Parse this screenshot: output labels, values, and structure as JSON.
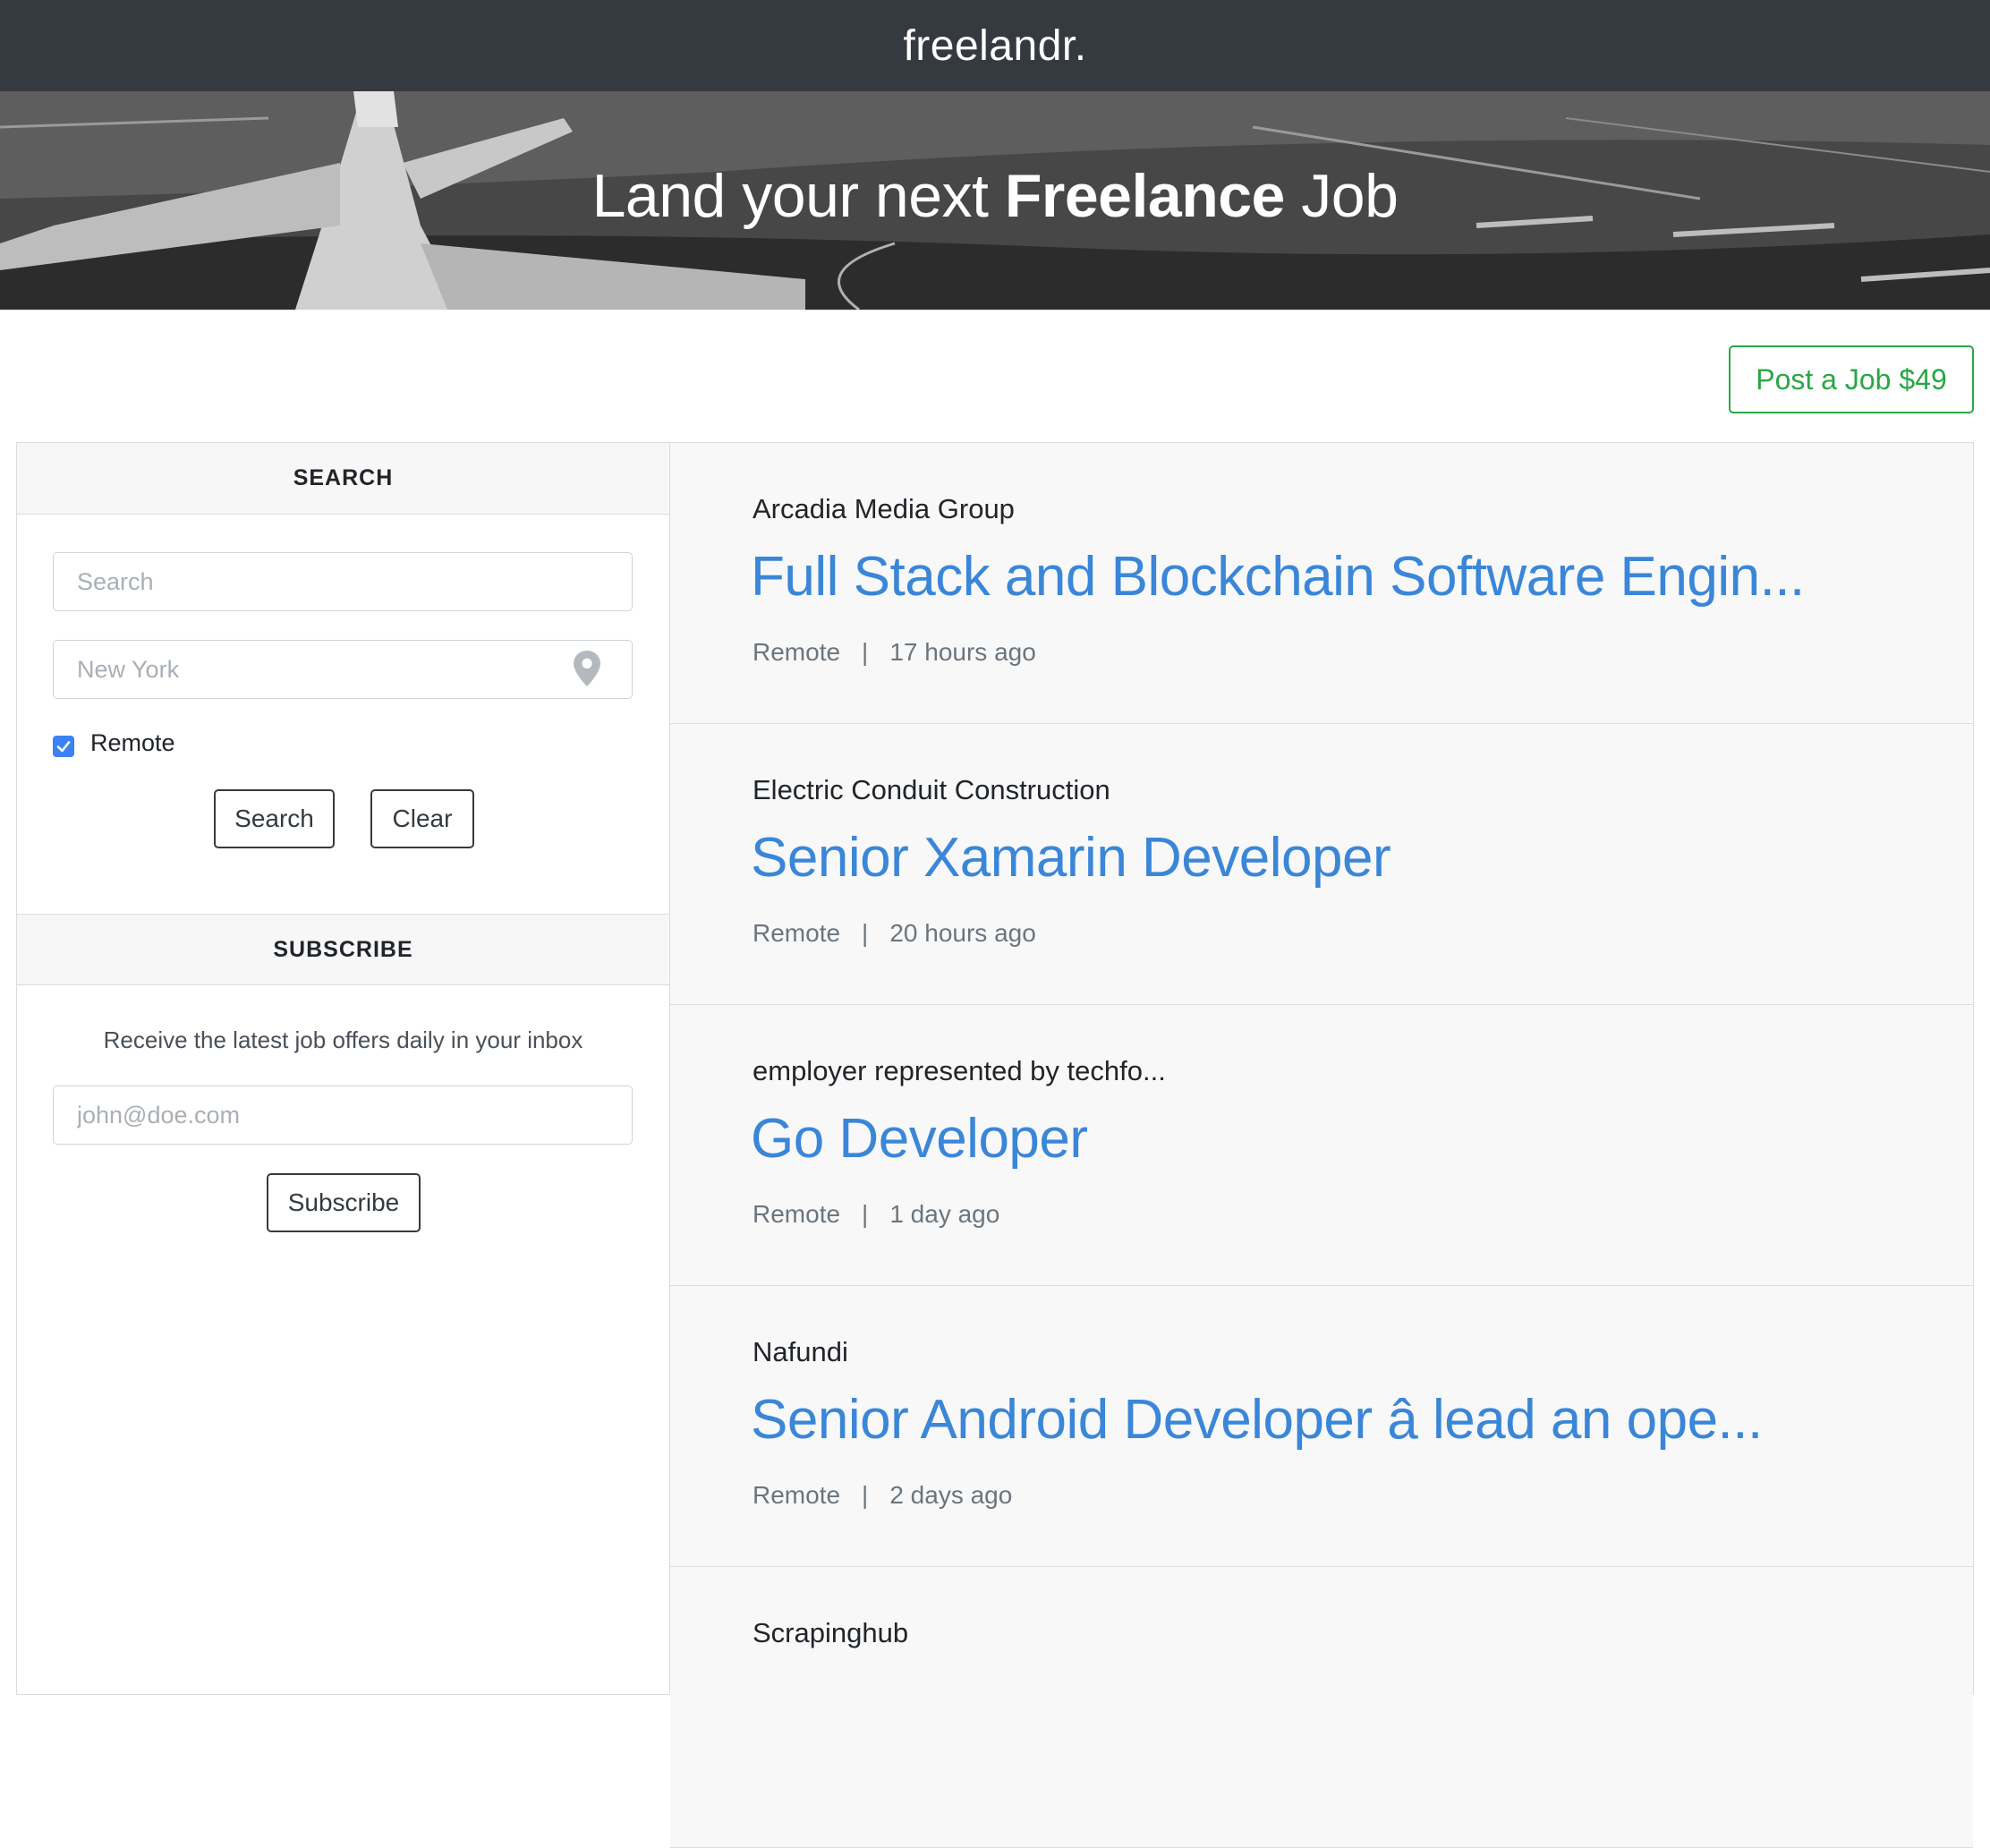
{
  "header": {
    "brand": "freelandr."
  },
  "hero": {
    "title_prefix": "Land your next ",
    "title_bold": "Freelance",
    "title_suffix": " Job"
  },
  "actions": {
    "post_job_label": "Post a Job $49"
  },
  "search": {
    "heading": "SEARCH",
    "query_placeholder": "Search",
    "location_placeholder": "New York",
    "remote_label": "Remote",
    "remote_checked": true,
    "search_button": "Search",
    "clear_button": "Clear"
  },
  "subscribe": {
    "heading": "SUBSCRIBE",
    "description": "Receive the latest job offers daily in your inbox",
    "email_placeholder": "john@doe.com",
    "button": "Subscribe"
  },
  "jobs": [
    {
      "company": "Arcadia Media Group",
      "title": "Full Stack and Blockchain Software Engin...",
      "location": "Remote",
      "posted": "17 hours ago"
    },
    {
      "company": "Electric Conduit Construction",
      "title": "Senior Xamarin Developer",
      "location": "Remote",
      "posted": "20 hours ago"
    },
    {
      "company": "employer represented by techfo...",
      "title": "Go Developer",
      "location": "Remote",
      "posted": "1 day ago"
    },
    {
      "company": "Nafundi",
      "title": "Senior Android Developer â lead an ope...",
      "location": "Remote",
      "posted": "2 days ago"
    },
    {
      "company": "Scrapinghub",
      "title": "",
      "location": "",
      "posted": ""
    }
  ],
  "meta_separator": "|",
  "colors": {
    "accent_green": "#28a745",
    "link_blue": "#3a86d8",
    "topbar": "#343a40",
    "checkbox": "#3b82f6"
  },
  "icons": {
    "location": "map-pin-icon",
    "checkbox": "checkmark-icon"
  }
}
